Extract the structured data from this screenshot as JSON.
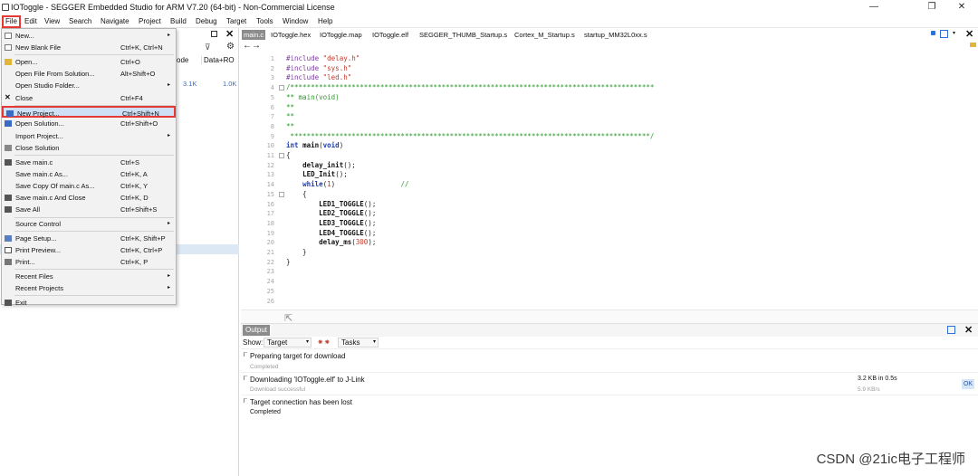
{
  "window": {
    "title": "IOToggle - SEGGER Embedded Studio for ARM V7.20 (64-bit) - Non-Commercial License",
    "minimize": "—",
    "restore": "❐",
    "close": "✕"
  },
  "menubar": [
    "File",
    "Edit",
    "View",
    "Search",
    "Navigate",
    "Project",
    "Build",
    "Debug",
    "Target",
    "Tools",
    "Window",
    "Help"
  ],
  "file_menu": [
    {
      "label": "New...",
      "shortcut": "",
      "arrow": "▸",
      "icon": "new-icon"
    },
    {
      "label": "New Blank File",
      "shortcut": "Ctrl+K, Ctrl+N",
      "arrow": "",
      "icon": "blank-file-icon"
    },
    {
      "label": "Open...",
      "shortcut": "Ctrl+O",
      "arrow": "",
      "icon": "open-folder-icon"
    },
    {
      "label": "Open File From Solution...",
      "shortcut": "Alt+Shift+O",
      "arrow": "",
      "icon": ""
    },
    {
      "label": "Open Studio Folder...",
      "shortcut": "",
      "arrow": "▸",
      "icon": ""
    },
    {
      "label": "Close",
      "shortcut": "Ctrl+F4",
      "arrow": "",
      "icon": "close-x-icon"
    },
    {
      "label": "New Project...",
      "shortcut": "Ctrl+Shift+N",
      "arrow": "",
      "icon": "new-project-icon"
    },
    {
      "label": "Open Solution...",
      "shortcut": "Ctrl+Shift+O",
      "arrow": "",
      "icon": "open-solution-icon"
    },
    {
      "label": "Import Project...",
      "shortcut": "",
      "arrow": "▸",
      "icon": ""
    },
    {
      "label": "Close Solution",
      "shortcut": "",
      "arrow": "",
      "icon": "close-solution-icon"
    },
    {
      "label": "Save main.c",
      "shortcut": "Ctrl+S",
      "arrow": "",
      "icon": "save-icon"
    },
    {
      "label": "Save main.c As...",
      "shortcut": "Ctrl+K, A",
      "arrow": "",
      "icon": ""
    },
    {
      "label": "Save Copy Of main.c As...",
      "shortcut": "Ctrl+K, Y",
      "arrow": "",
      "icon": ""
    },
    {
      "label": "Save main.c And Close",
      "shortcut": "Ctrl+K, D",
      "arrow": "",
      "icon": "save-close-icon"
    },
    {
      "label": "Save All",
      "shortcut": "Ctrl+Shift+S",
      "arrow": "",
      "icon": "save-all-icon"
    },
    {
      "label": "Source Control",
      "shortcut": "",
      "arrow": "▸",
      "icon": ""
    },
    {
      "label": "Page Setup...",
      "shortcut": "Ctrl+K, Shift+P",
      "arrow": "",
      "icon": "page-setup-icon"
    },
    {
      "label": "Print Preview...",
      "shortcut": "Ctrl+K, Ctrl+P",
      "arrow": "",
      "icon": "print-preview-icon"
    },
    {
      "label": "Print...",
      "shortcut": "Ctrl+K, P",
      "arrow": "",
      "icon": "print-icon"
    },
    {
      "label": "Recent Files",
      "shortcut": "",
      "arrow": "▸",
      "icon": ""
    },
    {
      "label": "Recent Projects",
      "shortcut": "",
      "arrow": "▸",
      "icon": ""
    },
    {
      "label": "Exit",
      "shortcut": "",
      "arrow": "",
      "icon": "exit-icon"
    }
  ],
  "left_panel": {
    "columns": [
      "ode",
      "Data+RO"
    ],
    "values": [
      "3.1K",
      "1.0K"
    ]
  },
  "editor": {
    "tabs": [
      "main.c",
      "IOToggle.hex",
      "IOToggle.map",
      "IOToggle.elf",
      "SEGGER_THUMB_Startup.s",
      "Cortex_M_Startup.s",
      "startup_MM32L0xx.s"
    ],
    "nav": "←→",
    "lines": [
      {
        "n": "1",
        "t": "#include \"delay.h\""
      },
      {
        "n": "2",
        "t": "#include \"sys.h\""
      },
      {
        "n": "3",
        "t": "#include \"led.h\""
      },
      {
        "n": "4",
        "t": "/*****************************************************************************************"
      },
      {
        "n": "5",
        "t": "** main(void)"
      },
      {
        "n": "6",
        "t": "**"
      },
      {
        "n": "7",
        "t": "**"
      },
      {
        "n": "8",
        "t": "**"
      },
      {
        "n": "9",
        "t": " ****************************************************************************************/"
      },
      {
        "n": "10",
        "t": "int main(void)"
      },
      {
        "n": "11",
        "t": "{"
      },
      {
        "n": "12",
        "t": "    delay_init();"
      },
      {
        "n": "13",
        "t": "    LED_Init();"
      },
      {
        "n": "14",
        "t": "    while(1)                //"
      },
      {
        "n": "15",
        "t": "    {"
      },
      {
        "n": "16",
        "t": "        LED1_TOGGLE();"
      },
      {
        "n": "17",
        "t": "        LED2_TOGGLE();"
      },
      {
        "n": "18",
        "t": "        LED3_TOGGLE();"
      },
      {
        "n": "19",
        "t": "        LED4_TOGGLE();"
      },
      {
        "n": "20",
        "t": "        delay_ms(300);"
      },
      {
        "n": "21",
        "t": "    }"
      },
      {
        "n": "22",
        "t": "}"
      },
      {
        "n": "23",
        "t": ""
      },
      {
        "n": "24",
        "t": ""
      },
      {
        "n": "25",
        "t": ""
      },
      {
        "n": "26",
        "t": ""
      }
    ]
  },
  "output": {
    "tab": "Output",
    "show_label": "Show:",
    "show_value": "Target",
    "tasks_label": "Tasks",
    "rows": [
      {
        "title": "Preparing target for download",
        "sub": "Completed",
        "right1": "",
        "right2": "",
        "btn": ""
      },
      {
        "title": "Downloading 'IOToggle.elf' to J-Link",
        "sub": "Download successful",
        "right1": "3.2 KB in 0.5s",
        "right2": "5.9 KB/s",
        "btn": "OK"
      },
      {
        "title": "Target connection has been lost",
        "sub": "Completed",
        "right1": "",
        "right2": "",
        "btn": ""
      }
    ]
  },
  "watermark": "CSDN @21ic电子工程师",
  "colors": {
    "highlight_border": "#e53935",
    "menu_selected": "#cde0f5",
    "tab_active": "#8c8c8c"
  }
}
